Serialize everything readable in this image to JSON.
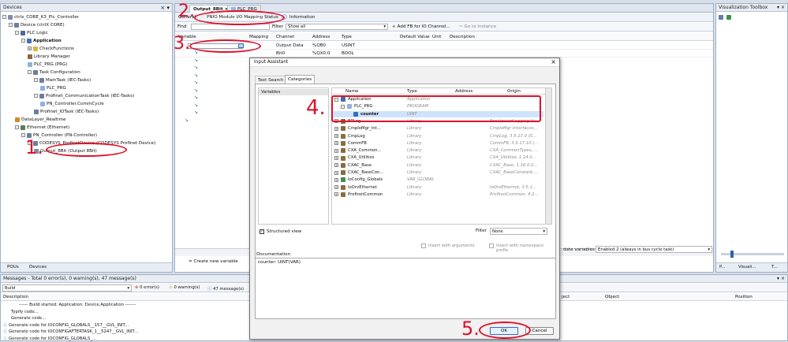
{
  "devices_panel": {
    "title": "Devices",
    "tree": [
      {
        "label": "ctrlx_CORE_K3_Plc_Controller",
        "indent": 0,
        "icon": "project-icon",
        "exp": "-"
      },
      {
        "label": "Device (ctrlX CORE)",
        "indent": 1,
        "icon": "device-icon",
        "exp": "-"
      },
      {
        "label": "PLC Logic",
        "indent": 2,
        "icon": "plc-icon",
        "exp": "-"
      },
      {
        "label": "Application",
        "indent": 3,
        "icon": "application-icon",
        "exp": "-",
        "bold": true
      },
      {
        "label": "CheckFunctions",
        "indent": 4,
        "icon": "folder-icon",
        "exp": "+"
      },
      {
        "label": "Library Manager",
        "indent": 4,
        "icon": "library-icon",
        "exp": ""
      },
      {
        "label": "PLC_PRG (PRG)",
        "indent": 4,
        "icon": "pou-icon",
        "exp": ""
      },
      {
        "label": "Task Configuration",
        "indent": 4,
        "icon": "task-icon",
        "exp": "-"
      },
      {
        "label": "MainTask (IEC-Tasks)",
        "indent": 5,
        "icon": "task-icon",
        "exp": "-"
      },
      {
        "label": "PLC_PRG",
        "indent": 6,
        "icon": "pou-icon",
        "exp": ""
      },
      {
        "label": "Profinet_CommunicationTask (IEC-Tasks)",
        "indent": 5,
        "icon": "task-icon",
        "exp": "-"
      },
      {
        "label": "PN_Controller.CommCycle",
        "indent": 6,
        "icon": "pou-icon",
        "exp": ""
      },
      {
        "label": "Profinet_IOTask (IEC-Tasks)",
        "indent": 5,
        "icon": "task-icon",
        "exp": ""
      },
      {
        "label": "DataLayer_Realtime",
        "indent": 2,
        "icon": "datalayer-icon",
        "exp": ""
      },
      {
        "label": "Ethernet (Ethernet)",
        "indent": 2,
        "icon": "ethernet-icon",
        "exp": "-"
      },
      {
        "label": "PN_Controller (PN-Controller)",
        "indent": 3,
        "icon": "controller-icon",
        "exp": "-"
      },
      {
        "label": "CODESYS_ProfinetDevice (CODESYS Profinet Device)",
        "indent": 4,
        "icon": "device-icon",
        "exp": "-"
      },
      {
        "label": "Output_8Bit (Output 8Bit)",
        "indent": 5,
        "icon": "module-icon",
        "exp": ""
      }
    ],
    "bottom_tabs": [
      "POUs",
      "Devices"
    ]
  },
  "editor": {
    "doc_tabs": [
      "Output_8Bit",
      "PLC_PRG"
    ],
    "inner_tabs": [
      "General",
      "PNIO Module I/O Mapping",
      "Status",
      "Information"
    ],
    "find_label": "Find",
    "filter_label": "Filter",
    "filter_value": "Show all",
    "add_fb_label": "Add FB for IO Channel...",
    "goto_label": "Go to Instance",
    "columns": [
      "Variable",
      "Mapping",
      "Channel",
      "Address",
      "Type",
      "Default Value",
      "Unit",
      "Description"
    ],
    "rows": [
      {
        "channel": "Output Data",
        "address": "%QB0",
        "type": "USINT"
      },
      {
        "channel": "Bit0",
        "address": "%QX0.0",
        "type": "BOOL"
      }
    ],
    "create_var_label": "= Create new variable",
    "update_vars_label": "date variables",
    "update_vars_value": "Enabled 2 (always in bus cycle task)"
  },
  "viz_toolbox": {
    "title": "Visualization Toolbox",
    "bottom_tabs": [
      "P...",
      "Visuali...",
      "T..."
    ]
  },
  "messages": {
    "title": "Messages - Total 0 error(s), 0 warning(s), 47 message(s)",
    "filter_value": "Build",
    "errors": "0 error(s)",
    "warnings": "0 warning(s)",
    "messages_count": "47 message(s)",
    "columns": [
      "Description",
      "ject",
      "Object",
      "Position"
    ],
    "rows": [
      "------ Build started: Application: Device.Application -------",
      "Typify code...",
      "Generate code...",
      "Generate code for IOCONFIG_GLOBALS__157__GVL_INIT...",
      "Generate code for IOCONFIGAFTERTASK_1__5247__GVL_INIT...",
      "Generate code for IOCONFIG_GLOBALS_..."
    ]
  },
  "input_assistant": {
    "title": "Input Assistant",
    "tabs": [
      "Text Search",
      "Categories"
    ],
    "categories": [
      "Variables"
    ],
    "columns": [
      "Name",
      "Type",
      "Address",
      "Origin"
    ],
    "items": [
      {
        "name": "Application",
        "type": "Application",
        "address": "",
        "origin": "",
        "exp": "-",
        "indent": 0,
        "icon": "application-icon"
      },
      {
        "name": "PLC_PRG",
        "type": "PROGRAM",
        "address": "",
        "origin": "",
        "exp": "-",
        "indent": 1,
        "icon": "pou-icon"
      },
      {
        "name": "counter",
        "type": "UINT",
        "address": "",
        "origin": "",
        "exp": "",
        "indent": 2,
        "icon": "variable-icon",
        "selected": true
      },
      {
        "name": "BPLog",
        "type": "Library",
        "address": "",
        "origin": "BreakpointLogging 3...",
        "exp": "+",
        "indent": 0,
        "icon": "library-icon"
      },
      {
        "name": "CmpIoMgr_Int...",
        "type": "Library",
        "address": "",
        "origin": "CmpIoMgr Interfaces...",
        "exp": "+",
        "indent": 0,
        "icon": "library-icon"
      },
      {
        "name": "CmpLog",
        "type": "Library",
        "address": "",
        "origin": "CmpLog, 3.5.17.0 (S...",
        "exp": "+",
        "indent": 0,
        "icon": "library-icon"
      },
      {
        "name": "CommFB",
        "type": "Library",
        "address": "",
        "origin": "CommFB, 3.5.17.10 (...",
        "exp": "+",
        "indent": 0,
        "icon": "library-icon"
      },
      {
        "name": "CXA_Common...",
        "type": "Library",
        "address": "",
        "origin": "CXA_CommonTypes, ...",
        "exp": "+",
        "indent": 0,
        "icon": "library-icon"
      },
      {
        "name": "CXA_Utilities",
        "type": "Library",
        "address": "",
        "origin": "CXA_Utilities, 1.14.0...",
        "exp": "+",
        "indent": 0,
        "icon": "library-icon"
      },
      {
        "name": "CXAC_Base",
        "type": "Library",
        "address": "",
        "origin": "CXAC_Base, 1.16.0.0...",
        "exp": "+",
        "indent": 0,
        "icon": "library-icon"
      },
      {
        "name": "CXAC_BaseCon...",
        "type": "Library",
        "address": "",
        "origin": "CXAC_BaseConstant,...",
        "exp": "+",
        "indent": 0,
        "icon": "library-icon"
      },
      {
        "name": "IoConfig_Globals",
        "type": "VAR_GLOBAL",
        "address": "",
        "origin": "",
        "exp": "+",
        "indent": 0,
        "icon": "globals-icon"
      },
      {
        "name": "IoDrvEthernet",
        "type": "Library",
        "address": "",
        "origin": "IoDrvEthernet, 3.5.1...",
        "exp": "+",
        "indent": 0,
        "icon": "library-icon"
      },
      {
        "name": "ProfinetCommon",
        "type": "Library",
        "address": "",
        "origin": "ProfinetCommon, 4.2...",
        "exp": "+",
        "indent": 0,
        "icon": "library-icon"
      }
    ],
    "structured_view_label": "Structured view",
    "filter_label": "Filter",
    "filter_value": "None",
    "insert_args_label": "Insert with arguments",
    "insert_ns_label": "Insert with namespace prefix",
    "documentation_label": "Documentation",
    "documentation_text": "counter: UINT(VAR)",
    "ok_label": "OK",
    "cancel_label": "Cancel"
  },
  "annotations": {
    "step1": "1.",
    "step2": "2.",
    "step3": "3.",
    "step4": "4.",
    "step5": "5."
  },
  "colors": {
    "annotation_red": "#e0102a",
    "selection_blue": "#cfe3fb",
    "titlebar": "#e8edf4"
  }
}
